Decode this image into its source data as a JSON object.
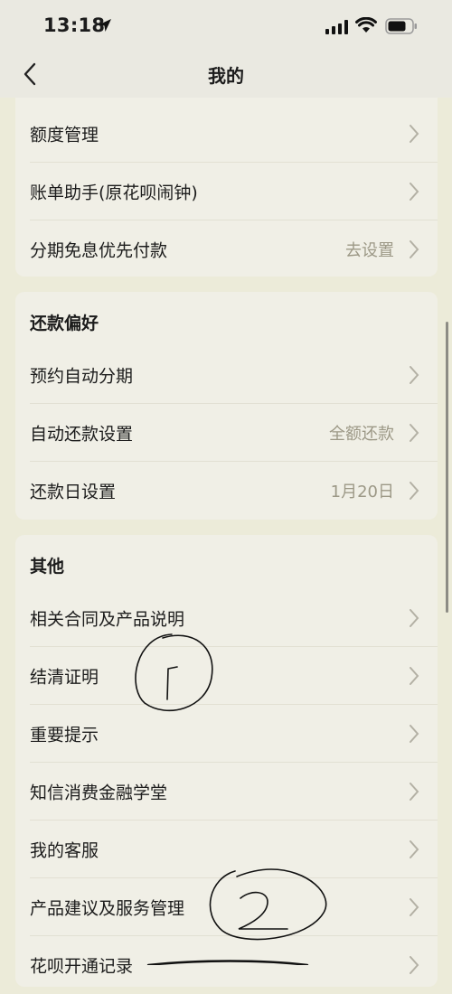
{
  "status_bar": {
    "time": "13:18"
  },
  "nav": {
    "title": "我的"
  },
  "card1": {
    "rows": [
      {
        "label": "额度管理",
        "value": ""
      },
      {
        "label": "账单助手(原花呗闹钟)",
        "value": ""
      },
      {
        "label": "分期免息优先付款",
        "value": "去设置"
      }
    ]
  },
  "card2": {
    "title": "还款偏好",
    "rows": [
      {
        "label": "预约自动分期",
        "value": ""
      },
      {
        "label": "自动还款设置",
        "value": "全额还款"
      },
      {
        "label": "还款日设置",
        "value": "1月20日"
      }
    ]
  },
  "card3": {
    "title": "其他",
    "rows": [
      {
        "label": "相关合同及产品说明",
        "value": ""
      },
      {
        "label": "结清证明",
        "value": ""
      },
      {
        "label": "重要提示",
        "value": ""
      },
      {
        "label": "知信消费金融学堂",
        "value": ""
      },
      {
        "label": "我的客服",
        "value": ""
      },
      {
        "label": "产品建议及服务管理",
        "value": ""
      },
      {
        "label": "花呗开通记录",
        "value": ""
      }
    ]
  },
  "colors": {
    "page_background": "#ecebd9",
    "card_background": "#f0efe6",
    "secondary_text": "#9c9886",
    "chevron": "#b3b0a4"
  },
  "icons": [
    "location-arrow-icon",
    "cellular-signal-icon",
    "wifi-icon",
    "battery-icon",
    "back-chevron-icon",
    "chevron-right-icon"
  ]
}
